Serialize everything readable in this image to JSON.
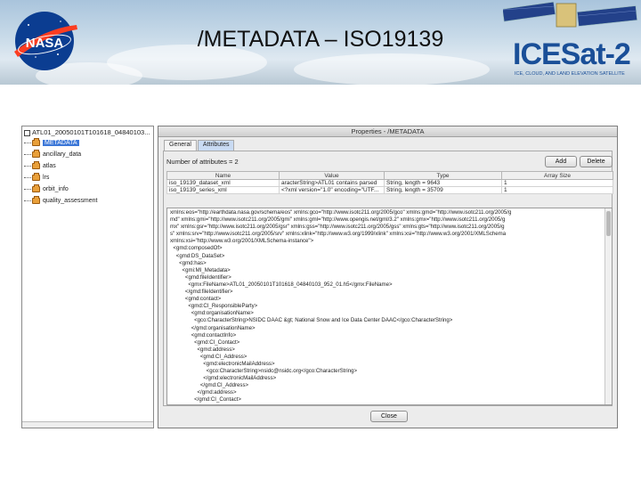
{
  "slide": {
    "title": "/METADATA – ISO19139"
  },
  "logos": {
    "nasa_text": "NASA",
    "icesat_text": "ICESat-2",
    "icesat_tagline": "ICE, CLOUD, AND LAND ELEVATION SATELLITE"
  },
  "colors": {
    "nasa_blue": "#0b3d91",
    "nasa_red": "#fc3d21",
    "icesat_blue": "#1a4f98",
    "selection": "#3d78d8"
  },
  "tree": {
    "root": "ATL01_20050101T101618_04840103...",
    "items": [
      {
        "label": "METADATA",
        "selected": true
      },
      {
        "label": "ancillary_data"
      },
      {
        "label": "atlas"
      },
      {
        "label": "lrs"
      },
      {
        "label": "orbit_info"
      },
      {
        "label": "quality_assessment"
      }
    ]
  },
  "properties": {
    "title": "Properties - /METADATA",
    "tabs": [
      "General",
      "Attributes"
    ],
    "active_tab": "Attributes",
    "attr_count": "Number of attributes = 2",
    "add_label": "Add",
    "delete_label": "Delete",
    "columns": [
      "Name",
      "Value",
      "Type",
      "Array Size"
    ],
    "rows": [
      [
        "iso_19139_dataset_xml",
        "aracterString>ATL01 contains parsed",
        "String, length = 9643",
        "1"
      ],
      [
        "iso_19139_series_xml",
        "<?xml version=\"1.0\" encoding=\"UTF...",
        "String, length = 35709",
        "1"
      ]
    ],
    "xml_lines": [
      "xmlns:eos=\"http://earthdata.nasa.gov/schema/eos\" xmlns:gco=\"http://www.isotc211.org/2005/gco\" xmlns:gmd=\"http://www.isotc211.org/2005/g",
      "md\" xmlns:gmi=\"http://www.isotc211.org/2005/gmi\" xmlns:gml=\"http://www.opengis.net/gml/3.2\" xmlns:gmx=\"http://www.isotc211.org/2005/g",
      "mx\" xmlns:gsr=\"http://www.isotc211.org/2005/gsr\" xmlns:gss=\"http://www.isotc211.org/2005/gss\" xmlns:gts=\"http://www.isotc211.org/2005/g",
      "s\" xmlns:srv=\"http://www.isotc211.org/2005/srv\" xmlns:xlink=\"http://www.w3.org/1999/xlink\" xmlns:xsi=\"http://www.w3.org/2001/XMLSchema",
      "xmlns:xsi=\"http://www.w3.org/2001/XMLSchema-instance\">",
      "  <gmd:composedOf>",
      "    <gmd:DS_DataSet>",
      "      <gmd:has>",
      "        <gmi:MI_Metadata>",
      "          <gmd:fileIdentifier>",
      "            <gmx:FileName>ATL01_20050101T101618_04840103_952_01.h5</gmx:FileName>",
      "          </gmd:fileIdentifier>",
      "          <gmd:contact>",
      "            <gmd:CI_ResponsibleParty>",
      "              <gmd:organisationName>",
      "                <gco:CharacterString>NSIDC DAAC &gt; National Snow and Ice Data Center DAAC</gco:CharacterString>",
      "              </gmd:organisationName>",
      "              <gmd:contactInfo>",
      "                <gmd:CI_Contact>",
      "                  <gmd:address>",
      "                    <gmd:CI_Address>",
      "                      <gmd:electronicMailAddress>",
      "                        <gco:CharacterString>nsidc@nsidc.org</gco:CharacterString>",
      "                      </gmd:electronicMailAddress>",
      "                    </gmd:CI_Address>",
      "                  </gmd:address>",
      "                </gmd:CI_Contact>"
    ],
    "close_label": "Close"
  }
}
